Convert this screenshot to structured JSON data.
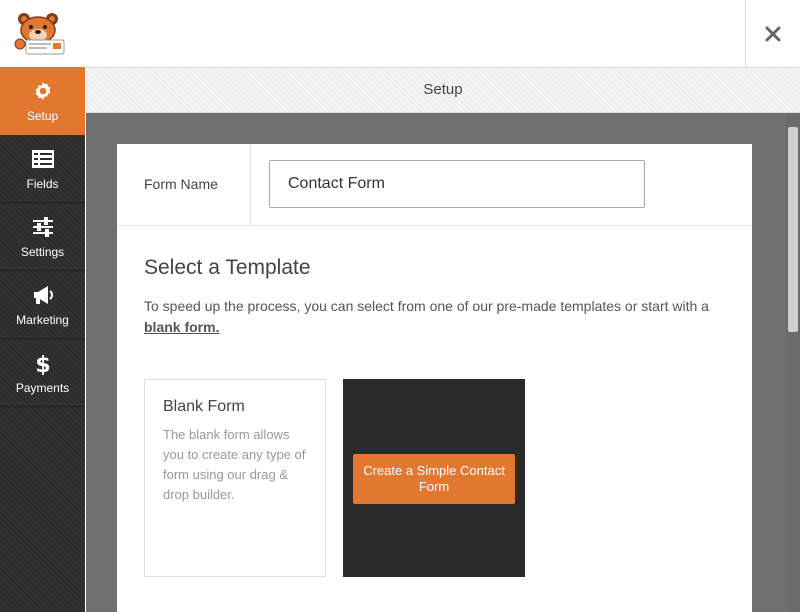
{
  "header": {
    "logo": "wpforms-bear-logo",
    "close_icon": "close-icon"
  },
  "sidebar": {
    "items": [
      {
        "label": "Setup",
        "icon": "gear-icon",
        "active": true
      },
      {
        "label": "Fields",
        "icon": "fields-list-icon",
        "active": false
      },
      {
        "label": "Settings",
        "icon": "sliders-icon",
        "active": false
      },
      {
        "label": "Marketing",
        "icon": "megaphone-icon",
        "active": false
      },
      {
        "label": "Payments",
        "icon": "dollar-icon",
        "active": false
      }
    ]
  },
  "panel": {
    "title": "Setup"
  },
  "form_name": {
    "label": "Form Name",
    "value": "Contact Form"
  },
  "templates": {
    "heading": "Select a Template",
    "description": "To speed up the process, you can select from one of our pre-made templates or start with a",
    "blank_link": "blank form.",
    "blank": {
      "title": "Blank Form",
      "description": "The blank form allows you to create any type of form using our drag & drop builder."
    },
    "simple": {
      "button": "Create a Simple Contact Form"
    }
  },
  "colors": {
    "accent": "#e27730",
    "sidebar": "#2d2d2d",
    "workspace": "#707070"
  }
}
